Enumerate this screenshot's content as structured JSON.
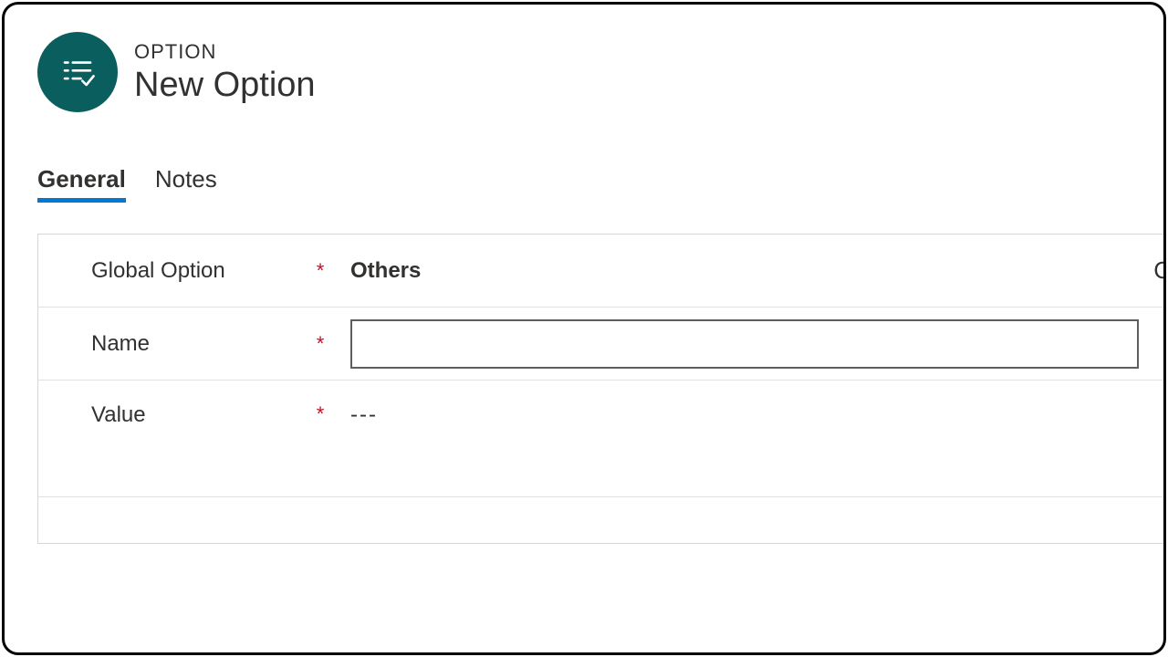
{
  "header": {
    "entity_label": "OPTION",
    "title": "New Option"
  },
  "tabs": [
    {
      "label": "General",
      "active": true
    },
    {
      "label": "Notes",
      "active": false
    }
  ],
  "form": {
    "global_option": {
      "label": "Global Option",
      "value": "Others"
    },
    "name": {
      "label": "Name",
      "value": ""
    },
    "value": {
      "label": "Value",
      "display": "---"
    }
  },
  "required_mark": "*"
}
